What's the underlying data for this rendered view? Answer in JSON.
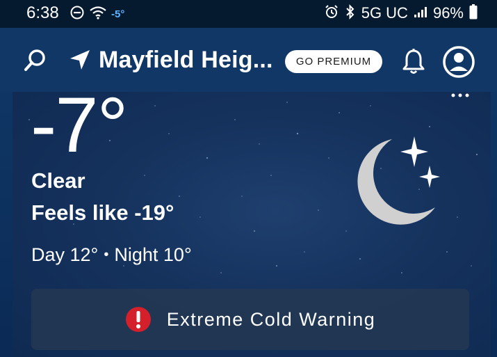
{
  "status_bar": {
    "time": "6:38",
    "temp_mini": "-5°",
    "network": "5G UC",
    "battery": "96%"
  },
  "header": {
    "location": "Mayfield Heig...",
    "premium_label": "GO PREMIUM"
  },
  "current": {
    "temperature": "-7°",
    "condition": "Clear",
    "feels_like": "Feels like -19°",
    "day_temp": "Day 12°",
    "separator": "•",
    "night_temp": "Night 10°",
    "icon": "moon-stars-icon"
  },
  "alert": {
    "text": "Extreme Cold Warning",
    "color": "#d3202a"
  },
  "colors": {
    "header_bg": "#113766",
    "status_bg": "#061a2f",
    "accent_temp": "#5fb3ff"
  }
}
